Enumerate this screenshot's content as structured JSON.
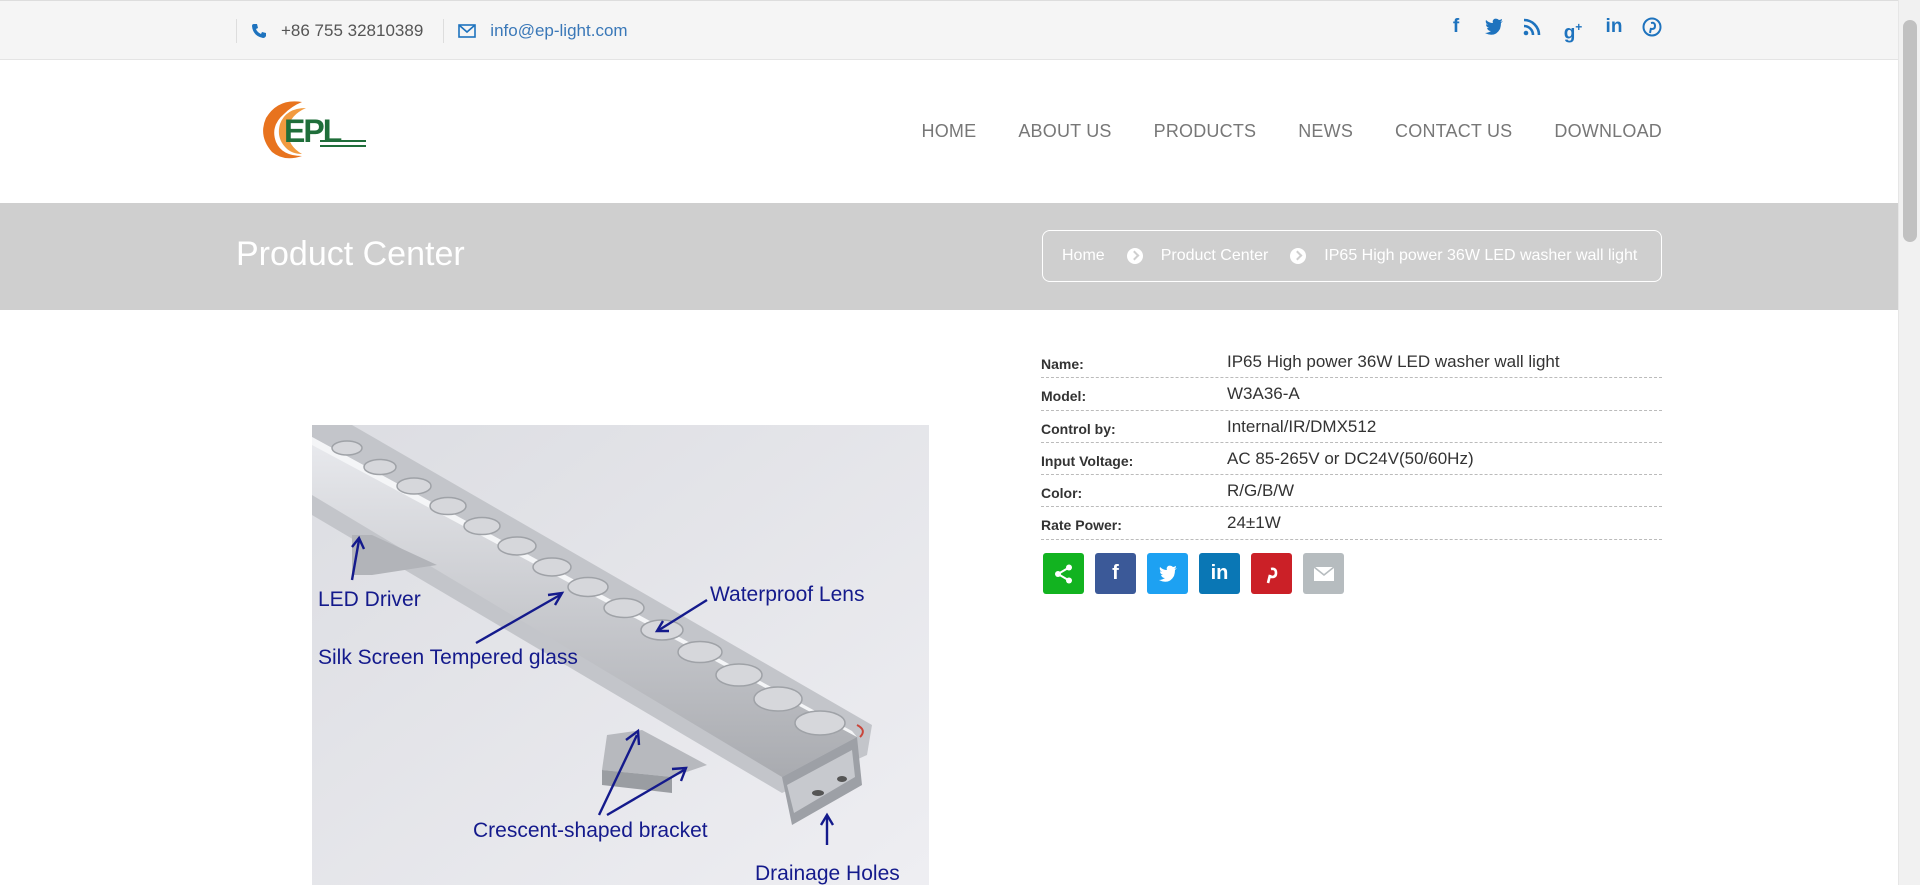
{
  "topbar": {
    "phone": "+86 755 32810389",
    "email": "info@ep-light.com",
    "social": [
      "facebook-icon",
      "twitter-icon",
      "rss-icon",
      "google-plus-icon",
      "linkedin-icon",
      "pinterest-icon"
    ],
    "accent": "#1e73be"
  },
  "header": {
    "logo_text": "EPL",
    "nav": [
      "HOME",
      "ABOUT US",
      "PRODUCTS",
      "NEWS",
      "CONTACT US",
      "DOWNLOAD"
    ]
  },
  "banner": {
    "title": "Product Center",
    "breadcrumb": [
      "Home",
      "Product Center",
      "IP65 High power 36W LED washer wall light"
    ]
  },
  "image_labels": {
    "led_driver": "LED Driver",
    "waterproof_lens": "Waterproof Lens",
    "silk_screen": "Silk Screen Tempered glass",
    "bracket": "Crescent-shaped bracket",
    "drainage": "Drainage Holes"
  },
  "specs": [
    {
      "label": "Name:",
      "value": "IP65 High power 36W LED washer wall light"
    },
    {
      "label": "Model:",
      "value": "W3A36-A"
    },
    {
      "label": "Control by:",
      "value": "Internal/IR/DMX512"
    },
    {
      "label": "Input Voltage:",
      "value": "AC 85-265V or DC24V(50/60Hz)"
    },
    {
      "label": "Color:",
      "value": "R/G/B/W"
    },
    {
      "label": "Rate Power:",
      "value": "24±1W"
    }
  ],
  "share": [
    {
      "name": "share-icon",
      "color": "#12b320"
    },
    {
      "name": "facebook-icon",
      "color": "#3b5998"
    },
    {
      "name": "twitter-icon",
      "color": "#1da1f2"
    },
    {
      "name": "linkedin-icon",
      "color": "#0a77b5"
    },
    {
      "name": "pinterest-icon",
      "color": "#cb2027"
    },
    {
      "name": "email-icon",
      "color": "#b6bcbf"
    }
  ]
}
